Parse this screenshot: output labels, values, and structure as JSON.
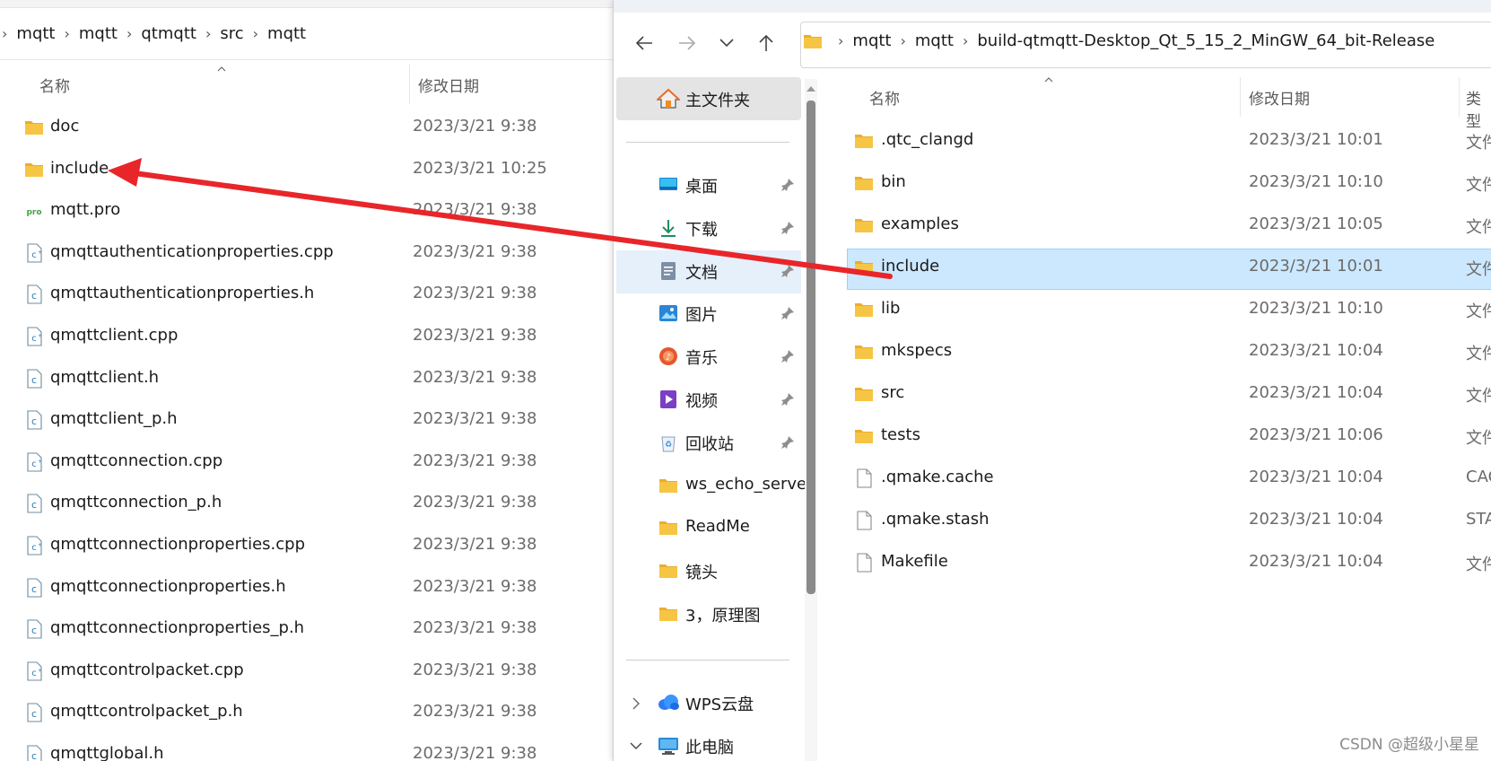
{
  "left_window": {
    "breadcrumbs": [
      "mqtt",
      "mqtt",
      "qtmqtt",
      "src",
      "mqtt"
    ],
    "columns": {
      "name": "名称",
      "date": "修改日期"
    },
    "files": [
      {
        "name": "doc",
        "date": "2023/3/21 9:38",
        "icon": "folder-icon"
      },
      {
        "name": "include",
        "date": "2023/3/21 10:25",
        "icon": "folder-icon"
      },
      {
        "name": "mqtt.pro",
        "date": "2023/3/21 9:38",
        "icon": "qt-project-icon",
        "icon_text": "pro"
      },
      {
        "name": "qmqttauthenticationproperties.cpp",
        "date": "2023/3/21 9:38",
        "icon": "cpp-file-icon"
      },
      {
        "name": "qmqttauthenticationproperties.h",
        "date": "2023/3/21 9:38",
        "icon": "header-file-icon"
      },
      {
        "name": "qmqttclient.cpp",
        "date": "2023/3/21 9:38",
        "icon": "cpp-file-icon"
      },
      {
        "name": "qmqttclient.h",
        "date": "2023/3/21 9:38",
        "icon": "header-file-icon"
      },
      {
        "name": "qmqttclient_p.h",
        "date": "2023/3/21 9:38",
        "icon": "header-file-icon"
      },
      {
        "name": "qmqttconnection.cpp",
        "date": "2023/3/21 9:38",
        "icon": "cpp-file-icon"
      },
      {
        "name": "qmqttconnection_p.h",
        "date": "2023/3/21 9:38",
        "icon": "header-file-icon"
      },
      {
        "name": "qmqttconnectionproperties.cpp",
        "date": "2023/3/21 9:38",
        "icon": "cpp-file-icon"
      },
      {
        "name": "qmqttconnectionproperties.h",
        "date": "2023/3/21 9:38",
        "icon": "header-file-icon"
      },
      {
        "name": "qmqttconnectionproperties_p.h",
        "date": "2023/3/21 9:38",
        "icon": "header-file-icon"
      },
      {
        "name": "qmqttcontrolpacket.cpp",
        "date": "2023/3/21 9:38",
        "icon": "cpp-file-icon"
      },
      {
        "name": "qmqttcontrolpacket_p.h",
        "date": "2023/3/21 9:38",
        "icon": "header-file-icon"
      },
      {
        "name": "qmqttglobal.h",
        "date": "2023/3/21 9:38",
        "icon": "header-file-icon"
      }
    ]
  },
  "right_window": {
    "breadcrumbs": [
      "mqtt",
      "mqtt",
      "build-qtmqtt-Desktop_Qt_5_15_2_MinGW_64_bit-Release"
    ],
    "columns": {
      "name": "名称",
      "date": "修改日期",
      "type": "类型"
    },
    "nav": {
      "home": "主文件夹",
      "quick_access": [
        {
          "label": "桌面",
          "icon": "desktop-icon"
        },
        {
          "label": "下载",
          "icon": "download-icon"
        },
        {
          "label": "文档",
          "icon": "documents-icon"
        },
        {
          "label": "图片",
          "icon": "pictures-icon"
        },
        {
          "label": "音乐",
          "icon": "music-icon"
        },
        {
          "label": "视频",
          "icon": "videos-icon"
        },
        {
          "label": "回收站",
          "icon": "recycle-bin-icon"
        },
        {
          "label": "ws_echo_server",
          "icon": "folder-icon"
        },
        {
          "label": "ReadMe",
          "icon": "folder-icon"
        },
        {
          "label": "镜头",
          "icon": "folder-icon"
        },
        {
          "label": "3，原理图",
          "icon": "folder-icon"
        }
      ],
      "wps": "WPS云盘",
      "this_pc": "此电脑"
    },
    "files": [
      {
        "name": ".qtc_clangd",
        "date": "2023/3/21 10:01",
        "type": "文件",
        "icon": "folder-icon"
      },
      {
        "name": "bin",
        "date": "2023/3/21 10:10",
        "type": "文件",
        "icon": "folder-icon"
      },
      {
        "name": "examples",
        "date": "2023/3/21 10:05",
        "type": "文件",
        "icon": "folder-icon"
      },
      {
        "name": "include",
        "date": "2023/3/21 10:01",
        "type": "文件",
        "icon": "folder-icon",
        "selected": true
      },
      {
        "name": "lib",
        "date": "2023/3/21 10:10",
        "type": "文件",
        "icon": "folder-icon"
      },
      {
        "name": "mkspecs",
        "date": "2023/3/21 10:04",
        "type": "文件",
        "icon": "folder-icon"
      },
      {
        "name": "src",
        "date": "2023/3/21 10:04",
        "type": "文件",
        "icon": "folder-icon"
      },
      {
        "name": "tests",
        "date": "2023/3/21 10:06",
        "type": "文件",
        "icon": "folder-icon"
      },
      {
        "name": ".qmake.cache",
        "date": "2023/3/21 10:04",
        "type": "CAC",
        "icon": "file-icon"
      },
      {
        "name": ".qmake.stash",
        "date": "2023/3/21 10:04",
        "type": "STA",
        "icon": "file-icon"
      },
      {
        "name": "Makefile",
        "date": "2023/3/21 10:04",
        "type": "文件",
        "icon": "file-icon"
      }
    ]
  },
  "watermark": "CSDN @超级小星星",
  "colors": {
    "folder": "#f7c544",
    "selection": "#cce8ff",
    "arrow": "#e8262a"
  }
}
